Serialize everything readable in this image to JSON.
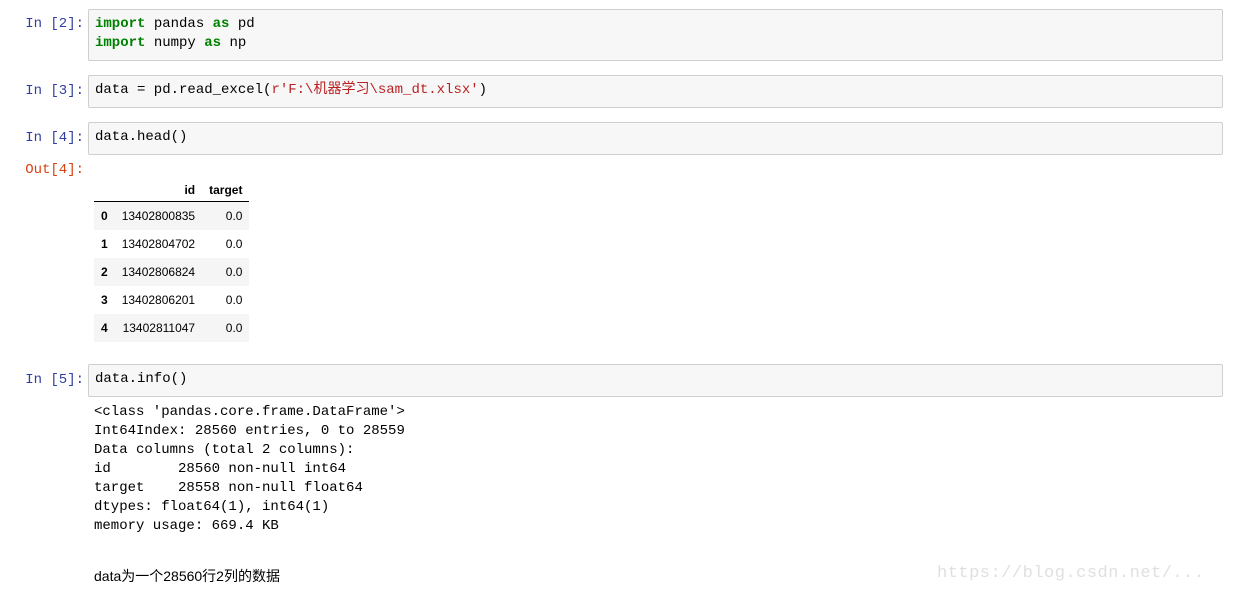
{
  "cells": [
    {
      "prompt": "In [2]:",
      "lines": [
        [
          {
            "t": "import",
            "c": "kw"
          },
          {
            "t": " pandas "
          },
          {
            "t": "as",
            "c": "kw"
          },
          {
            "t": " pd"
          }
        ],
        [
          {
            "t": "import",
            "c": "kw"
          },
          {
            "t": " numpy "
          },
          {
            "t": "as",
            "c": "kw"
          },
          {
            "t": " np"
          }
        ]
      ]
    },
    {
      "prompt": "In [3]:",
      "lines": [
        [
          {
            "t": "data = pd.read_excel("
          },
          {
            "t": "r'F:\\机器学习\\sam_dt.xlsx'",
            "c": "str"
          },
          {
            "t": ")"
          }
        ]
      ]
    },
    {
      "prompt": "In [4]:",
      "lines": [
        [
          {
            "t": "data.head()"
          }
        ]
      ]
    },
    {
      "prompt": "In [5]:",
      "lines": [
        [
          {
            "t": "data.info()"
          }
        ]
      ]
    }
  ],
  "out4": {
    "prompt": "Out[4]:",
    "columns": [
      "",
      "id",
      "target"
    ],
    "rows": [
      [
        "0",
        "13402800835",
        "0.0"
      ],
      [
        "1",
        "13402804702",
        "0.0"
      ],
      [
        "2",
        "13402806824",
        "0.0"
      ],
      [
        "3",
        "13402806201",
        "0.0"
      ],
      [
        "4",
        "13402811047",
        "0.0"
      ]
    ]
  },
  "out5": {
    "lines": [
      "<class 'pandas.core.frame.DataFrame'>",
      "Int64Index: 28560 entries, 0 to 28559",
      "Data columns (total 2 columns):",
      "id        28560 non-null int64",
      "target    28558 non-null float64",
      "dtypes: float64(1), int64(1)",
      "memory usage: 669.4 KB"
    ]
  },
  "note": "data为一个28560行2列的数据",
  "watermark": "https://blog.csdn.net/..."
}
